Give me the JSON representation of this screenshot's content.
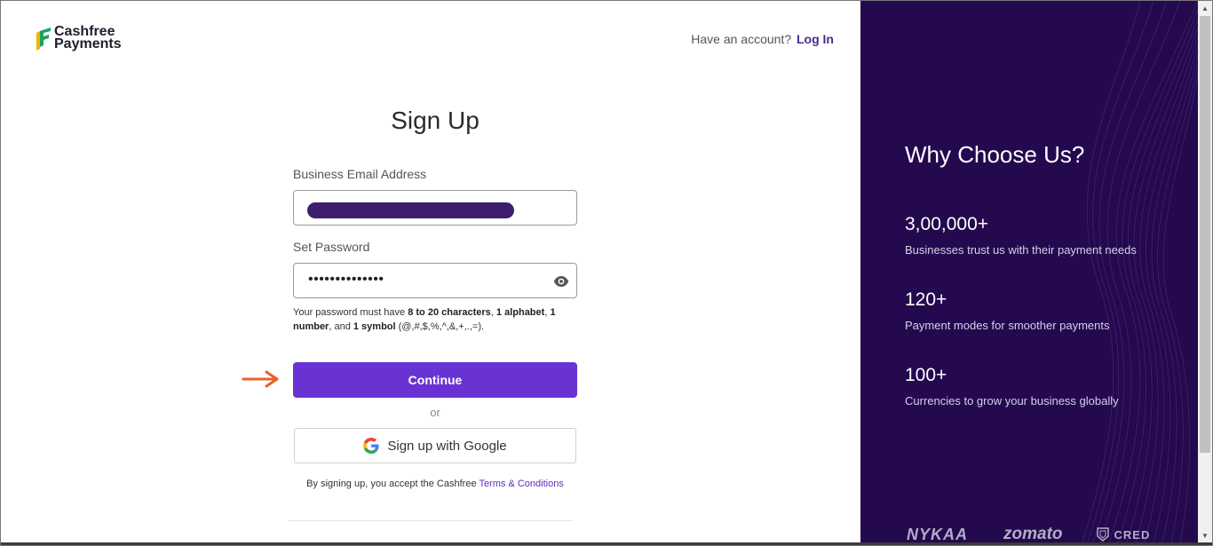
{
  "header": {
    "logo_line1": "Cashfree",
    "logo_line2": "Payments",
    "have_account": "Have an account?",
    "login_link": "Log In"
  },
  "form": {
    "title": "Sign Up",
    "email_label": "Business Email Address",
    "password_label": "Set Password",
    "password_value": "••••••••••••••",
    "hint": {
      "p1": "Your password must have ",
      "b1": "8 to 20 characters",
      "p2": ", ",
      "b2": "1 alphabet",
      "p3": ", ",
      "b3": "1 number",
      "p4": ", and ",
      "b4": "1 symbol",
      "p5": " (@,#,$,%,^,&,+,.,=)."
    },
    "continue_label": "Continue",
    "or_label": "or",
    "google_label": "Sign up with Google",
    "terms_prefix": "By signing up, you accept the Cashfree ",
    "terms_link": "Terms & Conditions"
  },
  "sidebar": {
    "heading": "Why Choose Us?",
    "stats": [
      {
        "value": "3,00,000+",
        "desc": "Businesses trust us with their payment needs"
      },
      {
        "value": "120+",
        "desc": "Payment modes for smoother payments"
      },
      {
        "value": "100+",
        "desc": "Currencies to grow your business globally"
      }
    ],
    "brands": [
      "NYKAA",
      "zomato",
      "CRED"
    ]
  },
  "colors": {
    "accent": "#6933d3",
    "sidebar_bg": "#24094f",
    "link": "#4b2a93",
    "arrow": "#e8602c"
  },
  "icons": [
    "logo-mark-icon",
    "eye-icon",
    "arrow-right-icon",
    "google-icon",
    "cred-shield-icon",
    "scroll-up-icon",
    "scroll-down-icon"
  ]
}
